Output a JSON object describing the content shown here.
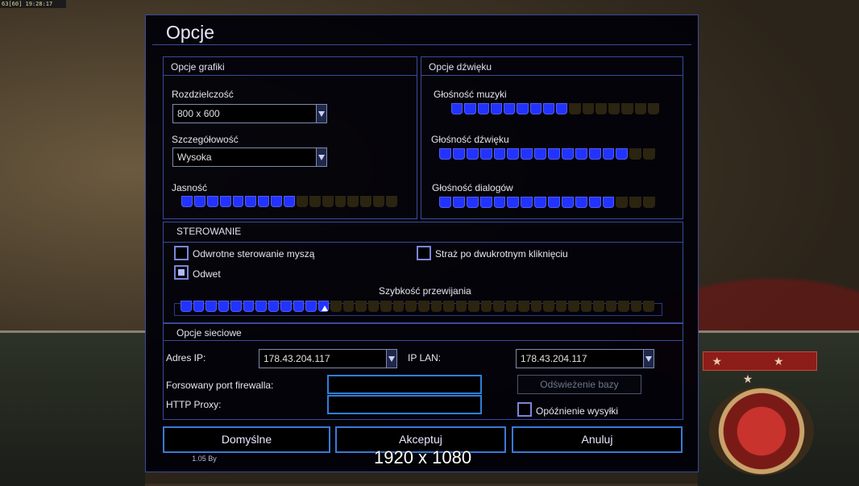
{
  "hud": {
    "fps_text": "63[60] 19:28:17",
    "stars": "★ ★ ★"
  },
  "dialog": {
    "title": "Opcje"
  },
  "graphics": {
    "title": "Opcje grafiki",
    "resolution_label": "Rozdzielczość",
    "resolution_value": "800 x 600",
    "detail_label": "Szczegółowość",
    "detail_value": "Wysoka",
    "brightness_label": "Jasność",
    "brightness_level": {
      "filled": 9,
      "total": 17
    }
  },
  "sound": {
    "title": "Opcje dźwięku",
    "music_label": "Głośność muzyki",
    "music_level": {
      "filled": 9,
      "total": 16
    },
    "sfx_label": "Głośność dźwięku",
    "sfx_level": {
      "filled": 14,
      "total": 16
    },
    "dialog_label": "Głośność dialogów",
    "dialog_level": {
      "filled": 13,
      "total": 16
    }
  },
  "controls": {
    "title": "STEROWANIE",
    "invert_mouse_label": "Odwrotne sterowanie myszą",
    "invert_mouse_checked": false,
    "guard_label": "Straż po dwukrotnym kliknięciu",
    "guard_checked": false,
    "retaliation_label": "Odwet",
    "retaliation_checked": true,
    "scroll_speed_label": "Szybkość przewijania",
    "scroll_speed_level": {
      "filled": 12,
      "total": 38
    }
  },
  "network": {
    "title": "Opcje sieciowe",
    "ip_label": "Adres IP:",
    "ip_value": "178.43.204.117",
    "lan_label": "IP LAN:",
    "lan_value": "178.43.204.117",
    "firewall_label": "Forsowany port firewalla:",
    "firewall_value": "",
    "proxy_label": "HTTP Proxy:",
    "proxy_value": "",
    "refresh_label": "Odświeżenie bazy",
    "send_delay_label": "Opóźnienie wysyłki",
    "send_delay_checked": false
  },
  "buttons": {
    "defaults": "Domyślne",
    "accept": "Akceptuj",
    "cancel": "Anuluj"
  },
  "footer": {
    "version": "1.05 By",
    "resolution_overlay": "1920 x 1080"
  }
}
